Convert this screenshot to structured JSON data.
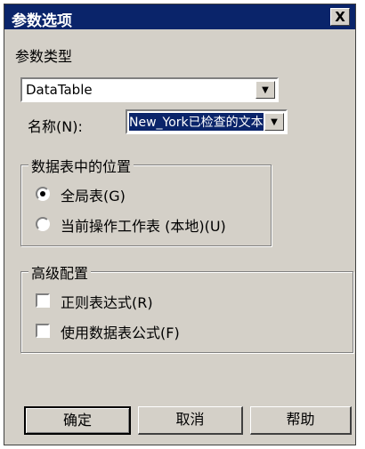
{
  "window": {
    "title": "参数选项",
    "close_label": "X"
  },
  "param_type": {
    "label": "参数类型",
    "selected": "DataTable"
  },
  "name_field": {
    "label": "名称(N):",
    "value": "New_York已检查的文本"
  },
  "location_group": {
    "title": "数据表中的位置",
    "options": [
      {
        "label": "全局表(G)",
        "selected": true
      },
      {
        "label": "当前操作工作表 (本地)(U)",
        "selected": false
      }
    ]
  },
  "advanced_group": {
    "title": "高级配置",
    "options": [
      {
        "label": "正则表达式(R)",
        "checked": false
      },
      {
        "label": "使用数据表公式(F)",
        "checked": false
      }
    ]
  },
  "buttons": {
    "ok": "确定",
    "cancel": "取消",
    "help": "帮助"
  }
}
